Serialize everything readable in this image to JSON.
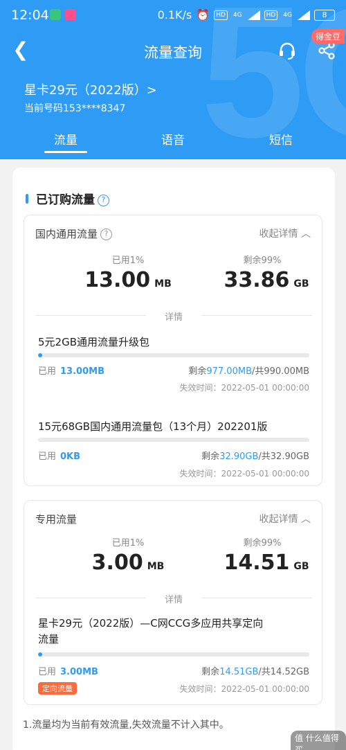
{
  "status_bar": {
    "time": "12:04",
    "network_speed": "0.1K/s",
    "hd1": "HD",
    "signal1": "4G",
    "hd2": "HD",
    "signal2": "4G",
    "battery": "8"
  },
  "nav": {
    "title": "流量查询",
    "badge": "得金豆"
  },
  "plan": {
    "name": "星卡29元（2022版）>",
    "number": "当前号码153****8347"
  },
  "tabs": [
    {
      "label": "流量",
      "active": true
    },
    {
      "label": "语音",
      "active": false
    },
    {
      "label": "短信",
      "active": false
    }
  ],
  "section": {
    "title": "已订购流量"
  },
  "cards": [
    {
      "title": "国内通用流量",
      "collapse": "收起详情",
      "used_label": "已用1%",
      "used_value": "13.00",
      "used_unit": "MB",
      "remain_label": "剩余99%",
      "remain_value": "33.86",
      "remain_unit": "GB",
      "detail_label": "详情",
      "packages": [
        {
          "name": "5元2GB通用流量升级包",
          "progress": 0.013,
          "used_label": "已用",
          "used_value": "13.00MB",
          "remain_prefix": "剩余",
          "remain_value": "977.00MB",
          "remain_total": "/共990.00MB",
          "expire": "失效时间：2022-05-01 00:00:00"
        },
        {
          "name": "15元68GB国内通用流量包（13个月）202201版",
          "progress": 0.0,
          "used_label": "已用",
          "used_value": "0KB",
          "remain_prefix": "剩余",
          "remain_value": "32.90GB",
          "remain_total": "/共32.90GB",
          "expire": "失效时间：2022-05-01 00:00:00"
        }
      ]
    },
    {
      "title": "专用流量",
      "collapse": "收起详情",
      "used_label": "已用1%",
      "used_value": "3.00",
      "used_unit": "MB",
      "remain_label": "剩余99%",
      "remain_value": "14.51",
      "remain_unit": "GB",
      "detail_label": "详情",
      "packages": [
        {
          "name_line1": "星卡29元（2022版）—C网CCG多应用共享定向",
          "name_line2": "流量",
          "progress": 0.005,
          "used_label": "已用",
          "used_value": "3.00MB",
          "remain_prefix": "剩余",
          "remain_value": "14.51GB",
          "remain_total": "/共14.52GB",
          "tag": "定向流量",
          "expire": "失效时间：2022-05-01 00:00:00"
        }
      ]
    }
  ],
  "notes": [
    "1.流量均为当前有效流量,失效流量不计入其中。"
  ],
  "watermark": "值 什么值得买",
  "colors": {
    "primary": "#2e9bf4",
    "tag": "#ff6a3a",
    "badge": "#ff6a6a"
  }
}
